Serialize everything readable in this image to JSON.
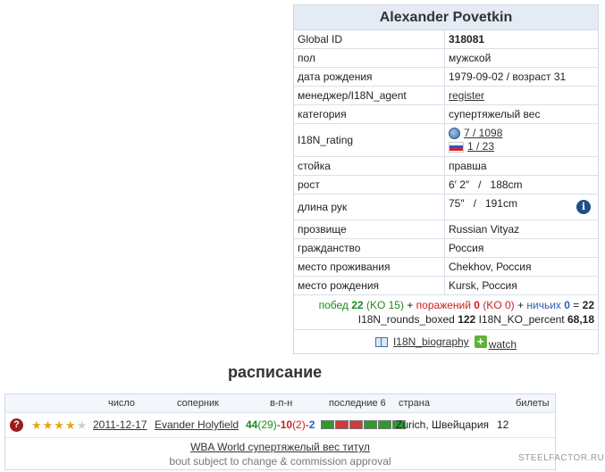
{
  "profile": {
    "name": "Alexander Povetkin",
    "rows": {
      "global_id": {
        "label": "Global ID",
        "value": "318081"
      },
      "sex": {
        "label": "пол",
        "value": "мужской"
      },
      "birth": {
        "label": "дата рождения",
        "value": "1979-09-02 / возраст 31"
      },
      "manager": {
        "label": "менеджер/I18N_agent",
        "value": "register"
      },
      "category": {
        "label": "категория",
        "value": "супертяжелый вес"
      },
      "rating": {
        "label": "I18N_rating",
        "world": "7 / 1098",
        "country": "1 / 23"
      },
      "stance": {
        "label": "стойка",
        "value": "правша"
      },
      "height": {
        "label": "рост",
        "value": "6′ 2″   /   188cm"
      },
      "reach": {
        "label": "длина рук",
        "value": "75″   /   191cm"
      },
      "alias": {
        "label": "прозвище",
        "value": "Russian Vityaz"
      },
      "citizenship": {
        "label": "гражданство",
        "value": "Россия"
      },
      "residence": {
        "label": "место проживания",
        "value": "Chekhov, Россия"
      },
      "birthplace": {
        "label": "место рождения",
        "value": "Kursk, Россия"
      }
    },
    "record": {
      "wins_label": "побед",
      "wins": "22",
      "wins_ko": "(KO 15)",
      "plus1": "+",
      "losses_label": "поражений",
      "losses": "0",
      "losses_ko": "(KO 0)",
      "plus2": "+",
      "draws_label": "ничьих",
      "draws": "0",
      "equals": "=",
      "total": "22",
      "rounds_label": "I18N_rounds_boxed",
      "rounds": "122",
      "ko_percent_label": "I18N_KO_percent",
      "ko_percent": "68,18"
    },
    "biography_link": "I18N_biography",
    "watch_link": "watch"
  },
  "schedule": {
    "title": "расписание",
    "headers": {
      "date": "число",
      "opponent": "соперник",
      "wld": "в-п-н",
      "last6": "последние 6",
      "country": "страна",
      "tickets": "билеты"
    },
    "bout": {
      "date": "2011-12-17",
      "opponent": "Evander Holyfield",
      "w": "44",
      "wko": "(29)",
      "dash1": "-",
      "l": "10",
      "lko": "(2)",
      "dash2": "-",
      "d": "2",
      "location": "Zurich, Швейцария",
      "rounds": "12",
      "stars_full": "★★★★",
      "stars_empty": "★",
      "last6_colors": [
        "#2f9a2f",
        "#d23a3a",
        "#d23a3a",
        "#2f9a2f",
        "#2f9a2f",
        "#2f9a2f"
      ],
      "title_fight": "WBA World супертяжелый вес титул",
      "note": "bout subject to change & commission approval"
    }
  },
  "watermark": "STEELFACTOR.RU",
  "colors": {
    "win": "#1e8a1e",
    "loss": "#cc1f1f",
    "draw": "#2b61b8"
  }
}
